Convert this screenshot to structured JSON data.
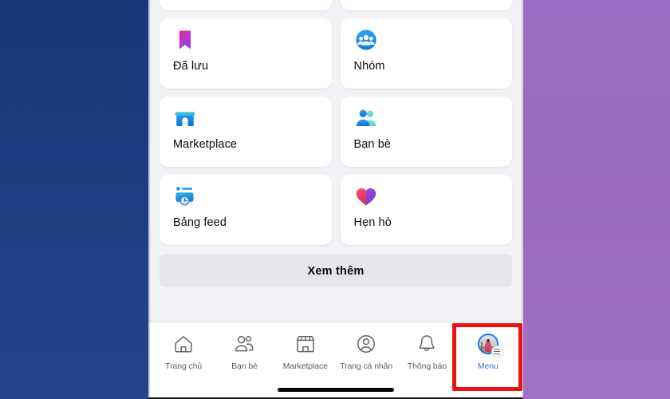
{
  "decor": {
    "left_color": "#1b3a7a",
    "right_color": "#9a6bbd"
  },
  "app": {
    "accent_color": "#1877f2",
    "highlight_color": "#ee1111",
    "background": "#f0f2f5"
  },
  "menu": {
    "shortcuts": [
      {
        "label": "Đã lưu",
        "icon": "bookmark-icon"
      },
      {
        "label": "Nhóm",
        "icon": "groups-icon"
      },
      {
        "label": "Marketplace",
        "icon": "marketplace-icon"
      },
      {
        "label": "Bạn bè",
        "icon": "friends-icon"
      },
      {
        "label": "Bảng feed",
        "icon": "feed-icon"
      },
      {
        "label": "Hẹn hò",
        "icon": "dating-heart-icon"
      }
    ],
    "see_more_label": "Xem thêm"
  },
  "bottom_nav": {
    "items": [
      {
        "label": "Trang chủ",
        "icon": "home-icon",
        "active": false
      },
      {
        "label": "Bạn bè",
        "icon": "friends-outline-icon",
        "active": false
      },
      {
        "label": "Marketplace",
        "icon": "store-outline-icon",
        "active": false
      },
      {
        "label": "Trang cá nhân",
        "icon": "profile-circle-icon",
        "active": false
      },
      {
        "label": "Thông báo",
        "icon": "bell-icon",
        "active": false
      },
      {
        "label": "Menu",
        "icon": "avatar-menu-icon",
        "active": true
      }
    ]
  }
}
